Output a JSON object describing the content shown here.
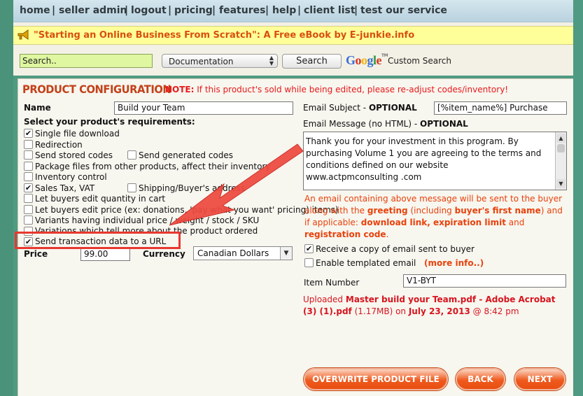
{
  "nav": {
    "items": [
      "home",
      "seller admin",
      "logout",
      "pricing",
      "features",
      "help",
      "client list",
      "test our service"
    ],
    "separator": "|"
  },
  "banner": {
    "icon": "megaphone-icon",
    "text": "\"Starting an Online Business From Scratch\": A Free eBook by E-junkie.info"
  },
  "search": {
    "value": "Search..",
    "scope": "Documentation",
    "button": "Search",
    "google_logo": "Google",
    "custom_search_label": "Custom Search"
  },
  "product": {
    "title": "PRODUCT CONFIGURATION",
    "note_prefix": "NOTE:",
    "note_text": " If this product's sold while being edited, please re-adjust codes/inventory!",
    "name_label": "Name",
    "name_value": "Build your Team",
    "requirements_label": "Select your product's requirements:",
    "requirements": [
      {
        "label": "Single file download",
        "checked": true
      },
      {
        "label": "Redirection",
        "checked": false
      },
      {
        "label": "Send stored codes",
        "checked": false
      },
      {
        "label": "Send generated codes",
        "checked": false
      },
      {
        "label": "Package files from other products, affect their inventory",
        "checked": false
      },
      {
        "label": "Inventory control",
        "checked": false
      },
      {
        "label": "Sales Tax, VAT",
        "checked": true
      },
      {
        "label": "Shipping/Buyer's address",
        "checked": false
      },
      {
        "label": "Let buyers edit quantity in cart",
        "checked": false
      },
      {
        "label": "Let buyers edit price (ex: donations, 'pay what you want' pricing) items)",
        "checked": false
      },
      {
        "label": "Variants having individual price / weight / stock / SKU",
        "checked": false
      },
      {
        "label": "Variations which tell more about the product ordered",
        "checked": false
      },
      {
        "label": "Send transaction data to a URL",
        "checked": true
      }
    ],
    "price_label": "Price",
    "price_value": "99.00",
    "currency_label": "Currency",
    "currency_value": "Canadian Dollars"
  },
  "email": {
    "subject_label": "Email Subject - ",
    "subject_optional": "OPTIONAL",
    "subject_value": "[%item_name%] Purchase",
    "message_label": "Email Message (no HTML) - ",
    "message_optional": "OPTIONAL",
    "message_value": "Thank you for your investment in this program. By purchasing Volume 1 you are agreeing to the terms and conditions defined on our website\nwww.actpmconsulting .com",
    "info_line1": "An email containing above message will be sent to the buyer",
    "info_line2_a": "along with the ",
    "info_line2_b": "greeting",
    "info_line2_c": " (including ",
    "info_line2_d": "buyer's first name",
    "info_line2_e": ") and",
    "info_line3_a": "if applicable: ",
    "info_line3_b": "download link, expiration limit",
    "info_line3_c": " and",
    "info_line4": "registration code",
    "info_line4_end": ".",
    "receive_copy_label": "Receive a copy of email sent to buyer",
    "receive_copy_checked": true,
    "templated_label": "Enable templated email",
    "templated_checked": false,
    "more_info": "(more info..)",
    "item_number_label": "Item Number",
    "item_number_value": "V1-BYT",
    "upload_prefix": "Uploaded ",
    "upload_file_1": "Master build your Team.pdf - Adobe Acrobat",
    "upload_file_2": "(3) (1).pdf",
    "upload_size": " (1.17MB) on ",
    "upload_date": "July 23, 2013",
    "upload_time": " @ 8:42 pm"
  },
  "buttons": {
    "overwrite": "OVERWRITE PRODUCT FILE",
    "back": "BACK",
    "next": "NEXT"
  },
  "colors": {
    "annotation_red": "#e8382f",
    "accent_orange": "#ef5a1e",
    "title_red": "#c2421a"
  }
}
